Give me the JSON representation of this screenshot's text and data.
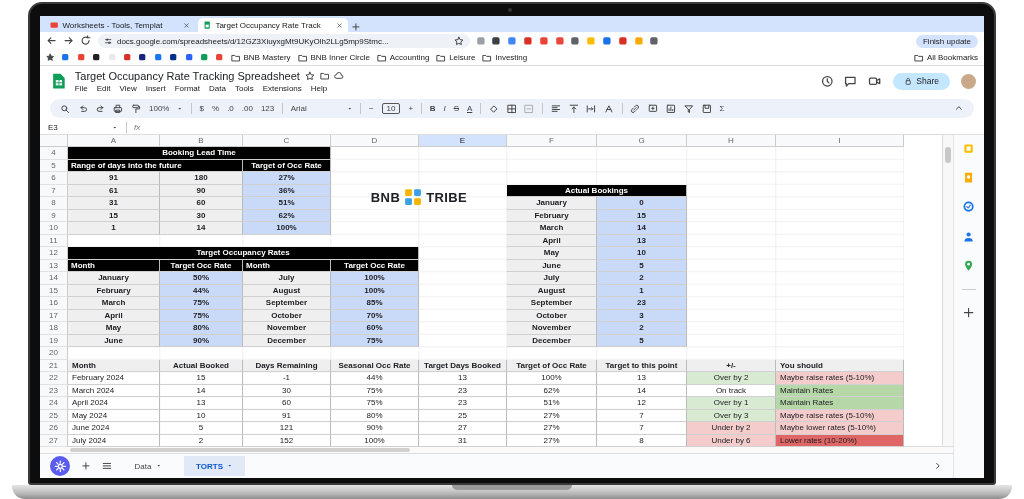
{
  "browser": {
    "tabs": [
      {
        "title": "Worksheets - Tools, Templat",
        "selected": false
      },
      {
        "title": "Target Occupancy Rate Track",
        "selected": true
      }
    ],
    "url": "docs.google.com/spreadsheets/d/12GZ3XiuyxgMt9UKyOlh2LLg5mp9Stmc...",
    "finish_update": "Finish update",
    "bookmark_folders": [
      "BNB Mastery",
      "BNB Inner Circle",
      "Accounting",
      "Leisure",
      "Investing"
    ],
    "all_bookmarks": "All Bookmarks"
  },
  "doc": {
    "title": "Target Occupancy Rate Tracking Spreadsheet",
    "menu": [
      "File",
      "Edit",
      "View",
      "Insert",
      "Format",
      "Data",
      "Tools",
      "Extensions",
      "Help"
    ],
    "share": "Share"
  },
  "toolbar": {
    "zoom": "100%",
    "number_formats": [
      "$",
      "%",
      ".0",
      ".00",
      "123"
    ],
    "font": "Arial",
    "minus": "−",
    "font_size": "10",
    "plus": "+",
    "text_styles": [
      "B",
      "I",
      "S",
      "A"
    ],
    "functions": "Σ"
  },
  "formula_bar": {
    "name_box": "E3",
    "fx": "fx"
  },
  "columns": [
    {
      "label": "A",
      "selected": false
    },
    {
      "label": "B",
      "selected": false
    },
    {
      "label": "C",
      "selected": false
    },
    {
      "label": "D",
      "selected": false
    },
    {
      "label": "E",
      "selected": true
    },
    {
      "label": "F",
      "selected": false
    },
    {
      "label": "G",
      "selected": false
    },
    {
      "label": "H",
      "selected": false
    },
    {
      "label": "I",
      "selected": false
    }
  ],
  "row_numbers": [
    "4",
    "5",
    "6",
    "7",
    "8",
    "9",
    "10",
    "11",
    "12",
    "13",
    "14",
    "15",
    "16",
    "17",
    "18",
    "19",
    "20",
    "21",
    "22",
    "23",
    "24",
    "25",
    "26",
    "27"
  ],
  "booking_lead_time": {
    "title": "Booking Lead Time",
    "headers": [
      "Range of days into the future",
      "Target of Occ Rate"
    ],
    "rows": [
      [
        "91",
        "180",
        "27%"
      ],
      [
        "61",
        "90",
        "36%"
      ],
      [
        "31",
        "60",
        "51%"
      ],
      [
        "15",
        "30",
        "62%"
      ],
      [
        "1",
        "14",
        "100%"
      ]
    ]
  },
  "target_occupancy_rates": {
    "title": "Target Occupancy Rates",
    "headers": [
      "Month",
      "Target Occ Rate",
      "Month",
      "Target Occ Rate"
    ],
    "rows": [
      [
        "January",
        "50%",
        "July",
        "100%"
      ],
      [
        "February",
        "44%",
        "August",
        "100%"
      ],
      [
        "March",
        "75%",
        "September",
        "85%"
      ],
      [
        "April",
        "75%",
        "October",
        "70%"
      ],
      [
        "May",
        "80%",
        "November",
        "60%"
      ],
      [
        "June",
        "90%",
        "December",
        "75%"
      ]
    ]
  },
  "logo": {
    "left": "BNB",
    "right": "TRIBE"
  },
  "actual_bookings": {
    "title": "Actual Bookings",
    "rows": [
      [
        "January",
        "0"
      ],
      [
        "February",
        "15"
      ],
      [
        "March",
        "14"
      ],
      [
        "April",
        "13"
      ],
      [
        "May",
        "10"
      ],
      [
        "June",
        "5"
      ],
      [
        "July",
        "2"
      ],
      [
        "August",
        "1"
      ],
      [
        "September",
        "23"
      ],
      [
        "October",
        "3"
      ],
      [
        "November",
        "2"
      ],
      [
        "December",
        "5"
      ]
    ]
  },
  "tracker": {
    "columns": [
      "Month",
      "Actual Booked",
      "Days Remaining",
      "Seasonal Occ Rate",
      "Target Days Booked",
      "Target of Occ Rate",
      "Target to this point",
      "+/-",
      "You should"
    ],
    "rows": [
      {
        "cells": [
          "February 2024",
          "15",
          "-1",
          "44%",
          "13",
          "100%",
          "13"
        ],
        "status": {
          "text": "Over by 2",
          "color": "#d9ead3"
        },
        "advice": {
          "text": "Maybe raise rates (5-10%)",
          "color": "#f4cccc"
        }
      },
      {
        "cells": [
          "March 2024",
          "14",
          "30",
          "75%",
          "23",
          "62%",
          "14"
        ],
        "status": {
          "text": "On track",
          "color": "#ffffff"
        },
        "advice": {
          "text": "Maintain Rates",
          "color": "#b6d7a8"
        }
      },
      {
        "cells": [
          "April 2024",
          "13",
          "60",
          "75%",
          "23",
          "51%",
          "12"
        ],
        "status": {
          "text": "Over by 1",
          "color": "#d9ead3"
        },
        "advice": {
          "text": "Maintain Rates",
          "color": "#b6d7a8"
        }
      },
      {
        "cells": [
          "May 2024",
          "10",
          "91",
          "80%",
          "25",
          "27%",
          "7"
        ],
        "status": {
          "text": "Over by 3",
          "color": "#d9ead3"
        },
        "advice": {
          "text": "Maybe raise rates (5-10%)",
          "color": "#f4cccc"
        }
      },
      {
        "cells": [
          "June 2024",
          "5",
          "121",
          "90%",
          "27",
          "27%",
          "7"
        ],
        "status": {
          "text": "Under by 2",
          "color": "#f4cccc"
        },
        "advice": {
          "text": "Maybe lower rates (5-10%)",
          "color": "#f4cccc"
        }
      },
      {
        "cells": [
          "July 2024",
          "2",
          "152",
          "100%",
          "31",
          "27%",
          "8"
        ],
        "status": {
          "text": "Under by 6",
          "color": "#f4cccc"
        },
        "advice": {
          "text": "Lower rates (10-20%)",
          "color": "#e06666"
        }
      }
    ]
  },
  "sheet_tabs": [
    {
      "label": "Data",
      "selected": false
    },
    {
      "label": "TORTS",
      "selected": true
    }
  ]
}
